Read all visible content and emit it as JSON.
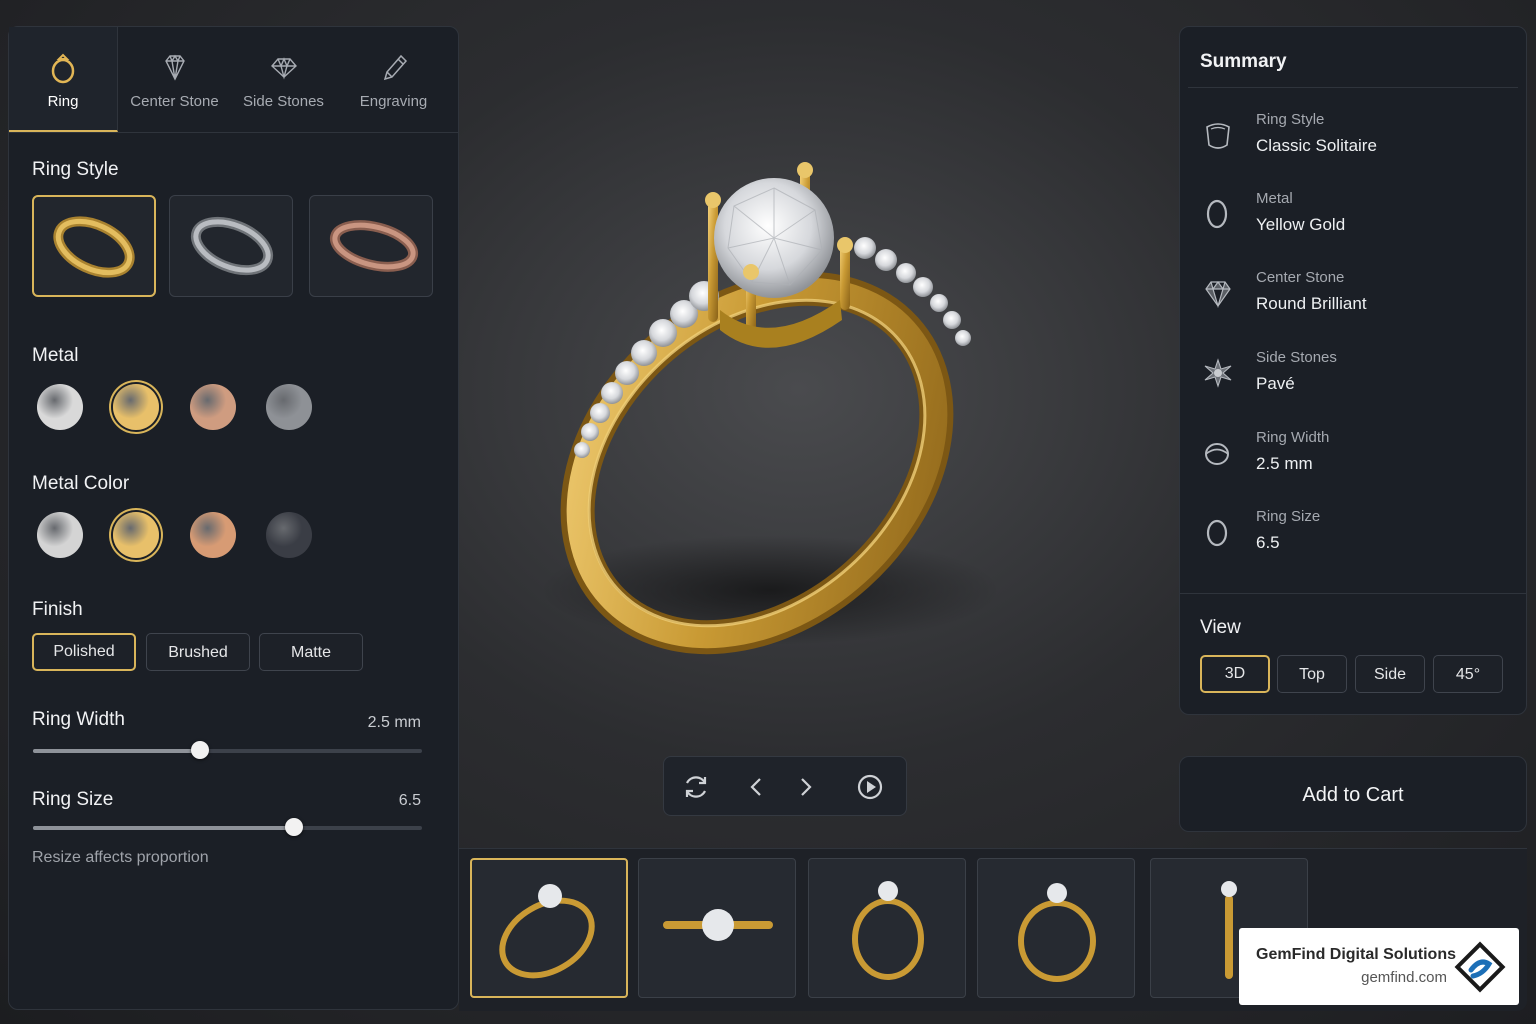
{
  "tabs": [
    {
      "label": "Ring",
      "icon": "ring-icon",
      "active": true
    },
    {
      "label": "Center Stone",
      "icon": "diamond-icon"
    },
    {
      "label": "Side Stones",
      "icon": "gem-icon"
    },
    {
      "label": "Engraving",
      "icon": "pencil-icon"
    }
  ],
  "ring_style": {
    "title": "Ring Style",
    "options": [
      {
        "icon": "yellow-gold-band-icon",
        "color": "#c9a24a",
        "selected": true
      },
      {
        "icon": "white-gold-band-icon",
        "color": "#9a9ea4"
      },
      {
        "icon": "rose-gold-band-icon",
        "color": "#b07c68"
      }
    ]
  },
  "metal": {
    "title": "Metal",
    "swatches": [
      "#d9d9d9",
      "#e8c06a",
      "#cf9c80",
      "#8e9196"
    ],
    "selected_index": 1
  },
  "metal_color": {
    "title": "Metal Color",
    "swatches": [
      "#d4d4d4",
      "#e8c06a",
      "#d79b74",
      "#3a3d45"
    ],
    "selected_index": 1
  },
  "finish": {
    "title": "Finish",
    "options": [
      "Polished",
      "Brushed",
      "Matte"
    ],
    "selected_index": 0
  },
  "ring_width": {
    "title": "Ring Width",
    "value": "2.5 mm",
    "fraction": 0.43
  },
  "ring_size": {
    "title": "Ring Size",
    "value": "6.5",
    "fraction": 0.67,
    "note": "Resize affects proportion"
  },
  "viewer_controls": [
    "rotate-icon",
    "chevron-left-icon",
    "chevron-right-icon",
    "play-icon"
  ],
  "thumbnails": [
    {
      "view": "angled",
      "selected": true
    },
    {
      "view": "top"
    },
    {
      "view": "front"
    },
    {
      "view": "front-alt"
    },
    {
      "view": "side"
    }
  ],
  "summary": {
    "title": "Summary",
    "items": [
      {
        "label": "Ring Style",
        "value": "Classic Solitaire",
        "icon": "ring-style-icon"
      },
      {
        "label": "Metal",
        "value": "Yellow Gold",
        "icon": "metal-ring-icon"
      },
      {
        "label": "Center Stone",
        "value": "Round Brilliant",
        "icon": "center-stone-icon"
      },
      {
        "label": "Side Stones",
        "value": "Pavé",
        "icon": "side-stones-icon"
      },
      {
        "label": "Ring Width",
        "value": "2.5 mm",
        "icon": "ring-width-icon"
      },
      {
        "label": "Ring Size",
        "value": "6.5",
        "icon": "ring-size-icon"
      }
    ]
  },
  "view": {
    "title": "View",
    "options": [
      "3D",
      "Top",
      "Side",
      "45°"
    ],
    "selected_index": 0
  },
  "cart": {
    "label": "Add to Cart"
  },
  "brand": {
    "name": "GemFind Digital Solutions",
    "url": "gemfind.com",
    "logo_color": "#1c6fb7"
  },
  "colors": {
    "accent": "#d9b55a",
    "panel": "#1b1f26",
    "gold": "#c9a24a"
  }
}
